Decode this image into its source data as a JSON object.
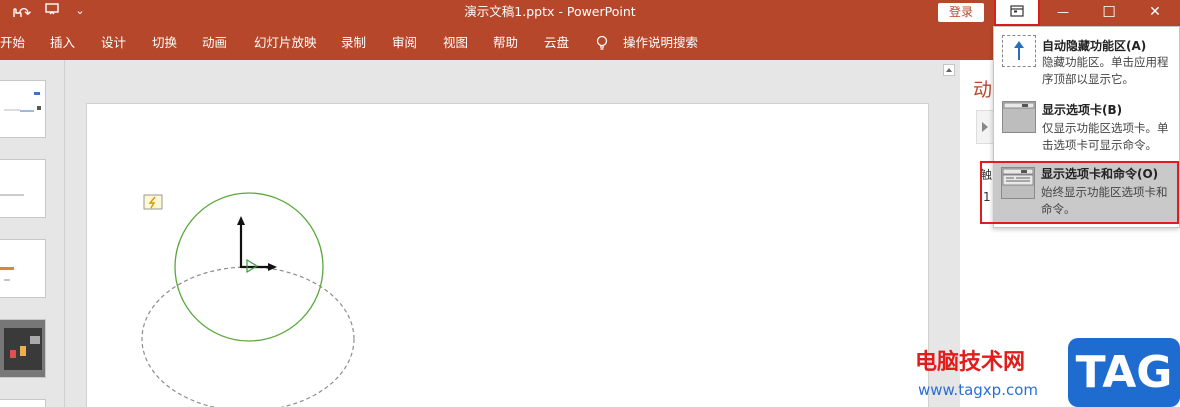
{
  "titlebar": {
    "title": "演示文稿1.pptx  -  PowerPoint",
    "login_label": "登录",
    "minimize_glyph": "—",
    "maximize_glyph": "☐",
    "close_glyph": "✕",
    "quick_access": {
      "redo_glyph": "↷",
      "customize_glyph": "⌄"
    }
  },
  "ribbon": {
    "tabs": [
      {
        "label": "开始"
      },
      {
        "label": "插入"
      },
      {
        "label": "设计"
      },
      {
        "label": "切换"
      },
      {
        "label": "动画"
      },
      {
        "label": "幻灯片放映"
      },
      {
        "label": "录制"
      },
      {
        "label": "审阅"
      },
      {
        "label": "视图"
      },
      {
        "label": "帮助"
      },
      {
        "label": "云盘"
      }
    ],
    "tell_me": "操作说明搜索"
  },
  "ribbon_display_menu": {
    "options": [
      {
        "title": "自动隐藏功能区(A)",
        "desc": "隐藏功能区。单击应用程序顶部以显示它。"
      },
      {
        "title": "显示选项卡(B)",
        "desc": "仅显示功能区选项卡。单击选项卡可显示命令。"
      },
      {
        "title": "显示选项卡和命令(O)",
        "desc": "始终显示功能区选项卡和命令。"
      }
    ]
  },
  "animation_pane": {
    "title": "动",
    "item1": "触",
    "item2": "1"
  },
  "watermark": {
    "site_name": "电脑技术网",
    "url": "www.tagxp.com",
    "tag": "TAG"
  },
  "colors": {
    "brand": "#b7472a",
    "highlight_red": "#e01c1c",
    "circle_green": "#5aa83c"
  }
}
